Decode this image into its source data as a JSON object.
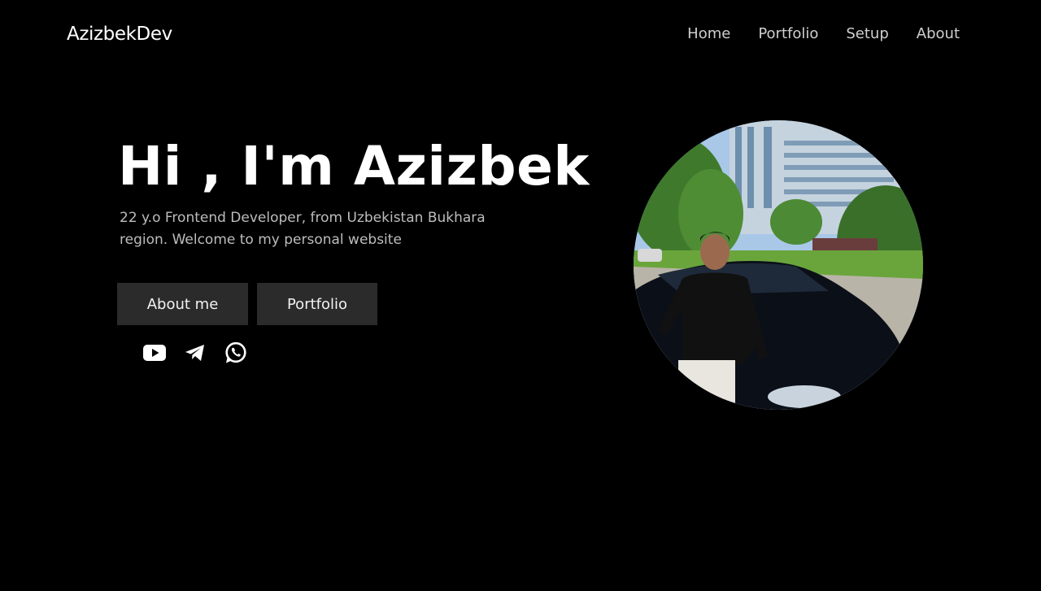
{
  "header": {
    "logo": "AzizbekDev",
    "nav": [
      "Home",
      "Portfolio",
      "Setup",
      "About"
    ]
  },
  "hero": {
    "title": "Hi , I'm Azizbek",
    "subtitle": "22 y.o Frontend Developer, from Uzbekistan Bukhara region. Welcome to my personal website",
    "buttons": {
      "about": "About me",
      "portfolio": "Portfolio"
    },
    "socials": [
      "youtube-icon",
      "telegram-icon",
      "whatsapp-icon"
    ]
  },
  "colors": {
    "background": "#000000",
    "button": "#2b2b2b",
    "nav_text": "#cfcfcf",
    "subtitle_text": "#bdbdbd"
  }
}
